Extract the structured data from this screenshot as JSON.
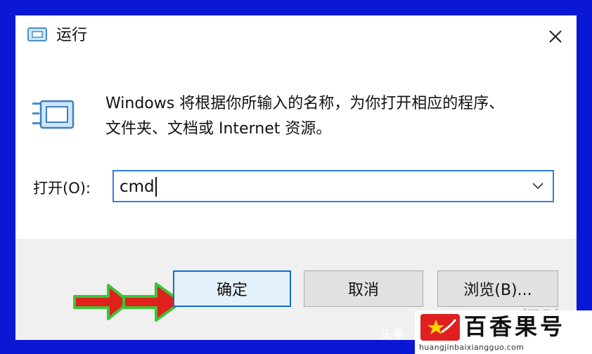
{
  "window": {
    "title": "运行",
    "close_glyph": "✕"
  },
  "description": {
    "line1": "Windows 将根据你所输入的名称，为你打开相应的程序、",
    "line2": "文件夹、文档或 Internet 资源。"
  },
  "open_field": {
    "label": "打开(O):",
    "value": "cmd"
  },
  "buttons": {
    "ok": "确定",
    "cancel": "取消",
    "browse": "浏览(B)..."
  },
  "watermarks": {
    "baidu": "Baidu 经验",
    "toutiao": "头条",
    "brand": "百香果号",
    "brand_url": "huangjinbaixiangguo.com"
  },
  "colors": {
    "frame_blue": "#0a18d6",
    "focus_blue": "#2f7de1",
    "arrow_red": "#e0201b",
    "arrow_green": "#3ec43a",
    "logo_red": "#e02020"
  }
}
